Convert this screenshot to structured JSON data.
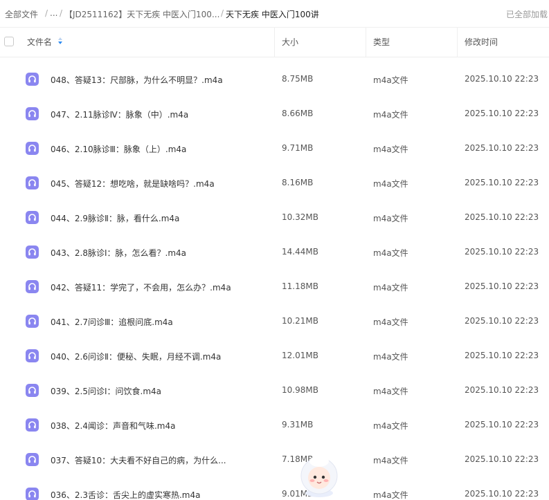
{
  "breadcrumb": {
    "root": "全部文件",
    "sep1": "/",
    "ellipsis": "...",
    "sep2": "/",
    "folder": "【JD2511162】天下无疾 中医入门100...",
    "sep3": "/",
    "current": "天下无疾 中医入门100讲",
    "loaded_status": "已全部加载"
  },
  "table": {
    "headers": {
      "name": "文件名",
      "size": "大小",
      "type": "类型",
      "modified": "修改时间"
    },
    "sort": {
      "column": "name",
      "direction": "descending"
    },
    "rows": [
      {
        "name": "048、答疑13：尺部脉，为什么不明显？.m4a",
        "size": "8.75MB",
        "type": "m4a文件",
        "modified": "2025.10.10 22:23"
      },
      {
        "name": "047、2.11脉诊Ⅳ：脉象（中）.m4a",
        "size": "8.66MB",
        "type": "m4a文件",
        "modified": "2025.10.10 22:23"
      },
      {
        "name": "046、2.10脉诊Ⅲ：脉象（上）.m4a",
        "size": "9.71MB",
        "type": "m4a文件",
        "modified": "2025.10.10 22:23"
      },
      {
        "name": "045、答疑12：想吃啥，就是缺啥吗？.m4a",
        "size": "8.16MB",
        "type": "m4a文件",
        "modified": "2025.10.10 22:23"
      },
      {
        "name": "044、2.9脉诊Ⅱ：脉，看什么.m4a",
        "size": "10.32MB",
        "type": "m4a文件",
        "modified": "2025.10.10 22:23"
      },
      {
        "name": "043、2.8脉诊Ⅰ：脉，怎么看？.m4a",
        "size": "14.44MB",
        "type": "m4a文件",
        "modified": "2025.10.10 22:23"
      },
      {
        "name": "042、答疑11：学完了，不会用，怎么办？.m4a",
        "size": "11.18MB",
        "type": "m4a文件",
        "modified": "2025.10.10 22:23"
      },
      {
        "name": "041、2.7问诊Ⅲ：追根问底.m4a",
        "size": "10.21MB",
        "type": "m4a文件",
        "modified": "2025.10.10 22:23"
      },
      {
        "name": "040、2.6问诊Ⅱ：便秘、失眠，月经不调.m4a",
        "size": "12.01MB",
        "type": "m4a文件",
        "modified": "2025.10.10 22:23"
      },
      {
        "name": "039、2.5问诊Ⅰ：问饮食.m4a",
        "size": "10.98MB",
        "type": "m4a文件",
        "modified": "2025.10.10 22:23"
      },
      {
        "name": "038、2.4闻诊：声音和气味.m4a",
        "size": "9.31MB",
        "type": "m4a文件",
        "modified": "2025.10.10 22:23"
      },
      {
        "name": "037、答疑10：大夫看不好自己的病，为什么...",
        "size": "7.18MB",
        "type": "m4a文件",
        "modified": "2025.10.10 22:23"
      },
      {
        "name": "036、2.3舌诊：舌尖上的虚实寒热.m4a",
        "size": "9.01MB",
        "type": "m4a文件",
        "modified": "2025.10.10 22:23"
      }
    ]
  },
  "icons": {
    "file": "headphones-icon",
    "sort": "sort-arrows-icon",
    "assistant": "mascot-avatar"
  },
  "colors": {
    "file_icon": "#8a86f0",
    "sort_active": "#2e8bf0"
  }
}
